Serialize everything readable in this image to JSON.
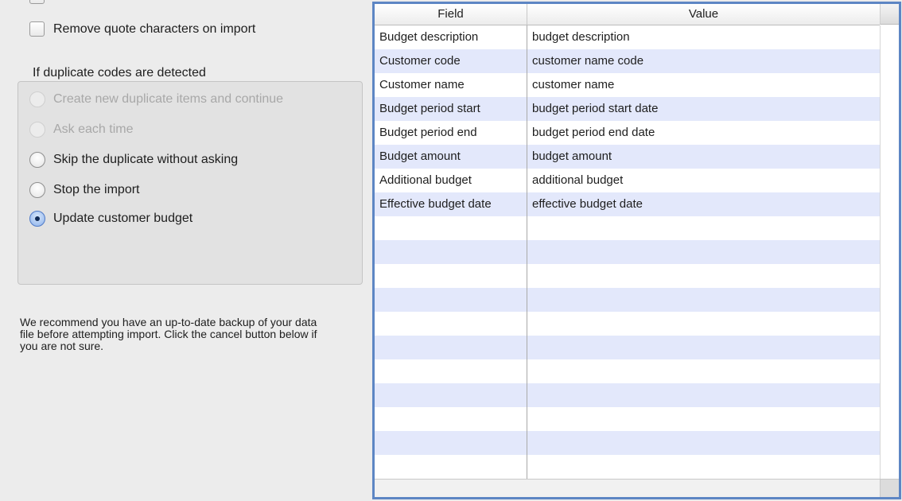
{
  "options": {
    "remove_quotes_label": "Remove quote characters on import",
    "remove_quotes_checked": false
  },
  "duplicates": {
    "title": "If duplicate codes are detected",
    "choices": [
      {
        "label": "Create new duplicate items and continue",
        "enabled": false,
        "selected": false
      },
      {
        "label": "Ask each time",
        "enabled": false,
        "selected": false
      },
      {
        "label": "Skip the duplicate without asking",
        "enabled": true,
        "selected": false
      },
      {
        "label": "Stop the import",
        "enabled": true,
        "selected": false
      },
      {
        "label": "Update customer budget",
        "enabled": true,
        "selected": true
      }
    ]
  },
  "note": "We recommend you have an up-to-date backup of your data file before attempting import. Click the cancel button below if you are not sure.",
  "table": {
    "headers": {
      "field": "Field",
      "value": "Value"
    },
    "rows": [
      {
        "field": "Budget description",
        "value": "budget description"
      },
      {
        "field": "Customer code",
        "value": "customer name code"
      },
      {
        "field": "Customer name",
        "value": "customer name"
      },
      {
        "field": "Budget period start",
        "value": "budget period start date"
      },
      {
        "field": "Budget period end",
        "value": "budget period end date"
      },
      {
        "field": "Budget amount",
        "value": "budget amount"
      },
      {
        "field": "Additional budget",
        "value": "additional budget"
      },
      {
        "field": "Effective budget date",
        "value": "effective budget date"
      },
      {
        "field": "",
        "value": ""
      },
      {
        "field": "",
        "value": ""
      },
      {
        "field": "",
        "value": ""
      },
      {
        "field": "",
        "value": ""
      },
      {
        "field": "",
        "value": ""
      },
      {
        "field": "",
        "value": ""
      },
      {
        "field": "",
        "value": ""
      },
      {
        "field": "",
        "value": ""
      },
      {
        "field": "",
        "value": ""
      },
      {
        "field": "",
        "value": ""
      },
      {
        "field": "",
        "value": ""
      }
    ]
  },
  "colors": {
    "selection_border": "#5d86c4",
    "row_alt": "#e3e8fb",
    "window_bg": "#ececec"
  }
}
